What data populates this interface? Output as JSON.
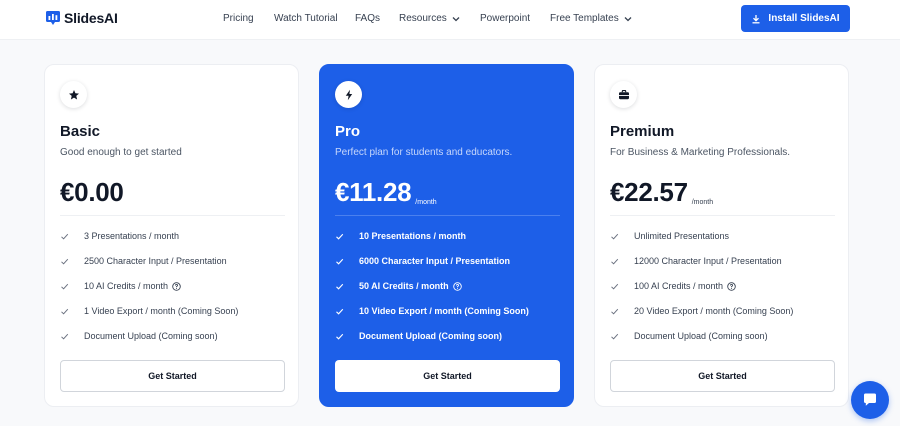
{
  "brand": {
    "name": "SlidesAI",
    "accent": "#1d5fe8"
  },
  "nav": {
    "links": [
      {
        "label": "Pricing",
        "dropdown": false
      },
      {
        "label": "Watch Tutorial",
        "dropdown": false
      },
      {
        "label": "FAQs",
        "dropdown": false
      },
      {
        "label": "Resources",
        "dropdown": true
      },
      {
        "label": "Powerpoint",
        "dropdown": false
      },
      {
        "label": "Free Templates",
        "dropdown": true
      }
    ],
    "install_label": "Install SlidesAI"
  },
  "plans": [
    {
      "icon": "star-icon",
      "name": "Basic",
      "description": "Good enough to get started",
      "price": "€0.00",
      "period": "",
      "features": [
        "3 Presentations / month",
        "2500 Character Input / Presentation",
        "10 AI Credits / month",
        "1 Video Export / month (Coming Soon)",
        "Document Upload (Coming soon)"
      ],
      "cta": "Get Started"
    },
    {
      "icon": "lightning-icon",
      "name": "Pro",
      "description": "Perfect plan for students and educators.",
      "price": "€11.28",
      "period": "/month",
      "features": [
        "10 Presentations / month",
        "6000 Character Input / Presentation",
        "50 AI Credits / month",
        "10 Video Export / month (Coming Soon)",
        "Document Upload (Coming soon)"
      ],
      "cta": "Get Started"
    },
    {
      "icon": "briefcase-icon",
      "name": "Premium",
      "description": "For Business & Marketing Professionals.",
      "price": "€22.57",
      "period": "/month",
      "features": [
        "Unlimited Presentations",
        "12000 Character Input / Presentation",
        "100 AI Credits / month",
        "20 Video Export / month (Coming Soon)",
        "Document Upload (Coming soon)"
      ],
      "cta": "Get Started"
    }
  ],
  "chat": {
    "icon": "chat-icon"
  }
}
